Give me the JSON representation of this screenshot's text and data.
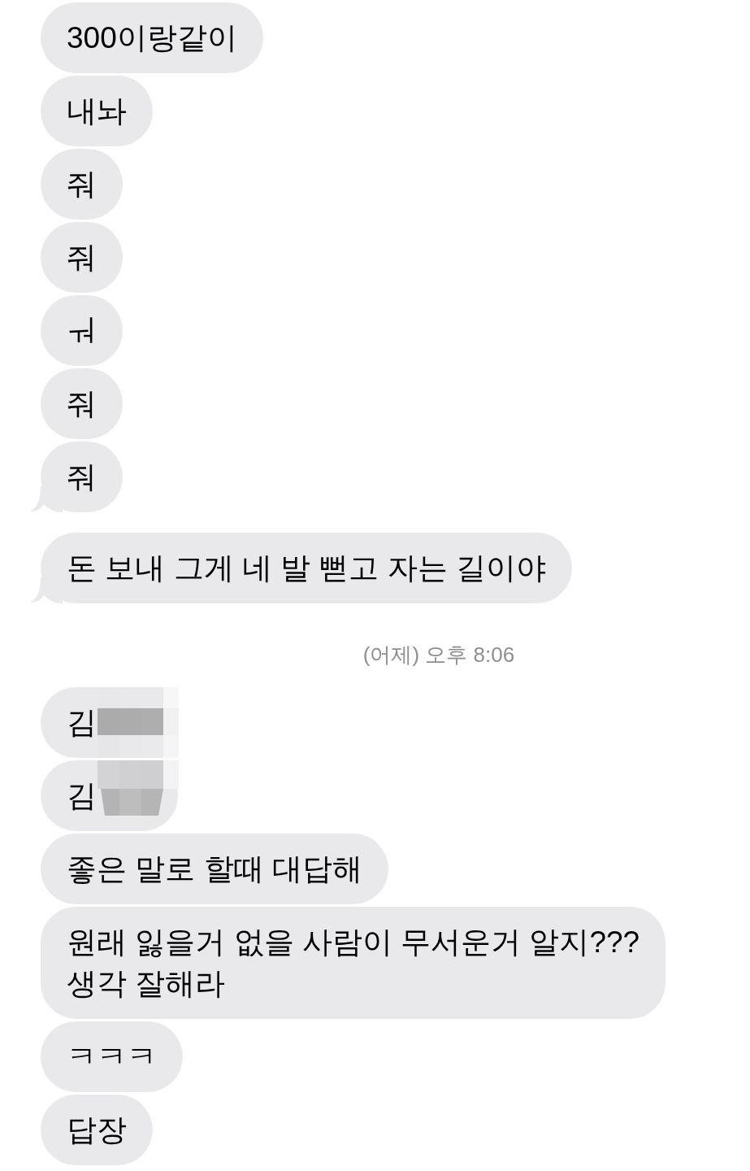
{
  "messages": [
    {
      "kind": "bubble",
      "text": "300이랑같이",
      "tail": false
    },
    {
      "kind": "bubble",
      "text": "내놔",
      "tail": false
    },
    {
      "kind": "bubble",
      "text": "줘",
      "tail": false
    },
    {
      "kind": "bubble",
      "text": "줘",
      "tail": false
    },
    {
      "kind": "bubble",
      "text": "ㅝ",
      "tail": false
    },
    {
      "kind": "bubble",
      "text": "줘",
      "tail": false
    },
    {
      "kind": "bubble",
      "text": "줘",
      "tail": true
    },
    {
      "kind": "bubble",
      "text": "돈 보내 그게 네 발 뻗고 자는 길이야",
      "tail": true
    },
    {
      "kind": "timestamp",
      "text": "(어제) 오후 8:06"
    },
    {
      "kind": "redacted",
      "text": "김",
      "tail": false
    },
    {
      "kind": "redacted",
      "text": "김",
      "tail": false
    },
    {
      "kind": "bubble",
      "text": "좋은 말로 할때 대답해",
      "tail": false
    },
    {
      "kind": "bubble",
      "text": "원래 잃을거 없을 사람이 무서운거 알지???\n생각 잘해라",
      "tail": false
    },
    {
      "kind": "bubble",
      "text": "ㅋㅋㅋ",
      "tail": false
    },
    {
      "kind": "bubble",
      "text": "답장",
      "tail": false
    }
  ]
}
